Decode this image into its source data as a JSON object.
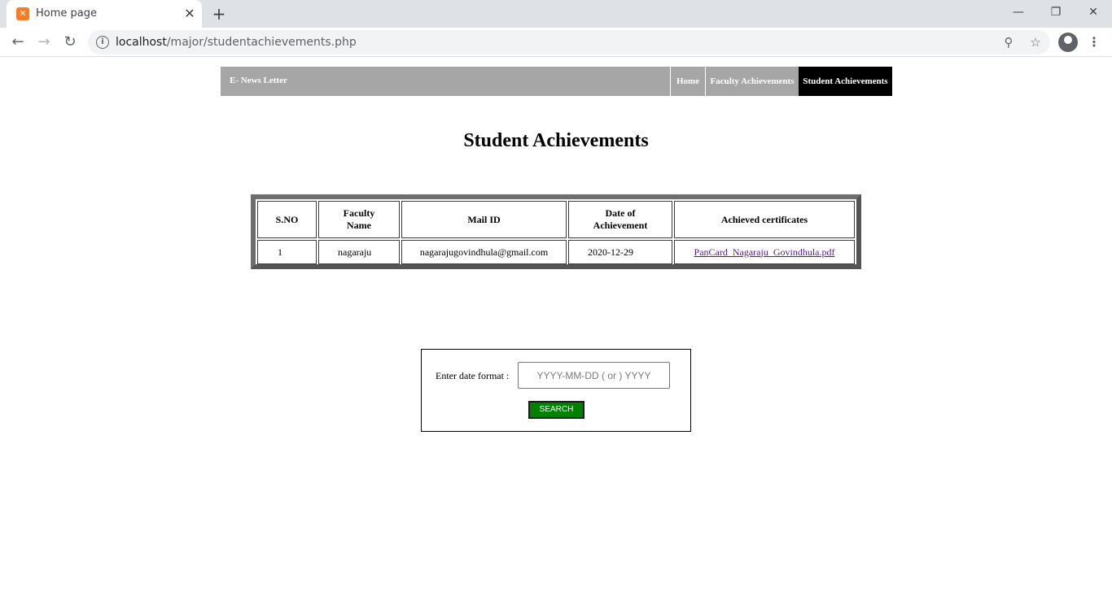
{
  "browser": {
    "tab_title": "Home page",
    "tab_favicon": "xampp-icon",
    "url_host": "localhost",
    "url_path": "/major/studentachievements.php"
  },
  "navbar": {
    "brand": "E- News Letter",
    "items": [
      {
        "label": "Home",
        "active": false
      },
      {
        "label": "Faculty Achievements",
        "active": false
      },
      {
        "label": "Student Achievements",
        "active": true
      }
    ]
  },
  "page": {
    "title": "Student Achievements"
  },
  "table": {
    "headers": [
      "S.NO",
      "Faculty Name",
      "Mail ID",
      "Date of Achievement",
      "Achieved certificates"
    ],
    "rows": [
      {
        "sno": "1",
        "name": "nagaraju",
        "mail": "nagarajugovindhula@gmail.com",
        "date": "2020-12-29",
        "certificate": "PanCard_Nagaraju_Govindhula.pdf"
      }
    ]
  },
  "search": {
    "label": "Enter date format :",
    "placeholder": "YYYY-MM-DD ( or ) YYYY",
    "value": "",
    "button_label": "SEARCH"
  },
  "colors": {
    "navbar_bg": "#a6a6a6",
    "nav_active_bg": "#000000",
    "search_button_bg": "#008000",
    "link_color": "#551a8b"
  }
}
